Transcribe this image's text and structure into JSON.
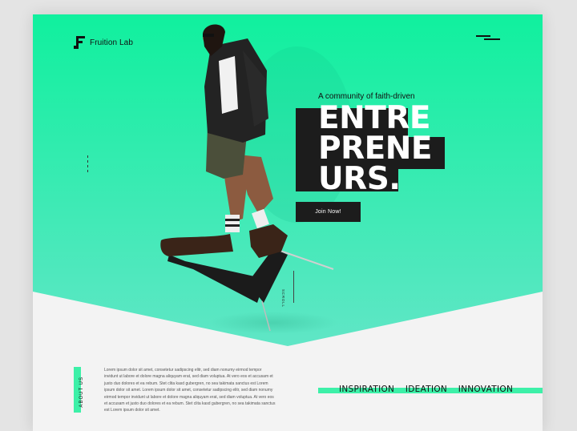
{
  "brand": {
    "name": "Fruition Lab"
  },
  "hero": {
    "tagline": "A community of faith-driven",
    "headline": [
      "ENTRE",
      "PRENE",
      "URS."
    ],
    "cta_label": "Join Now!",
    "scroll_label": "SCROLL"
  },
  "about": {
    "label": "ABOUT US",
    "text": "Lorem ipsum dolor sit amet, consetetur sadipscing elitr, sed diam nonumy eirmod tempor invidunt ut labore et dolore magna aliquyam erat, sed diam voluptua. At vero eos et accusam et justo duo dolores et ea rebum. Stet clita kasd gubergren, no sea takimata sanctus est Lorem ipsum dolor sit amet. Lorem ipsum dolor sit amet, consetetur sadipscing elitr, sed diam nonumy eirmod tempor invidunt ut labore et dolore magna aliquyam erat, sed diam voluptua. At vero eos et accusam et justo duo dolores et ea rebum. Stet clita kasd gubergren, no sea takimata sanctus est Lorem ipsum dolor sit amet."
  },
  "pillars": [
    "INSPIRATION",
    "IDEATION",
    "INNOVATION"
  ],
  "colors": {
    "accent": "#3df0a8",
    "hero_top": "#15f0a0",
    "hero_bottom": "#5ee6c4",
    "dark": "#1c1c1c"
  },
  "icons": {
    "logo": "fruition-logo-mark",
    "menu": "hamburger-menu-icon"
  }
}
